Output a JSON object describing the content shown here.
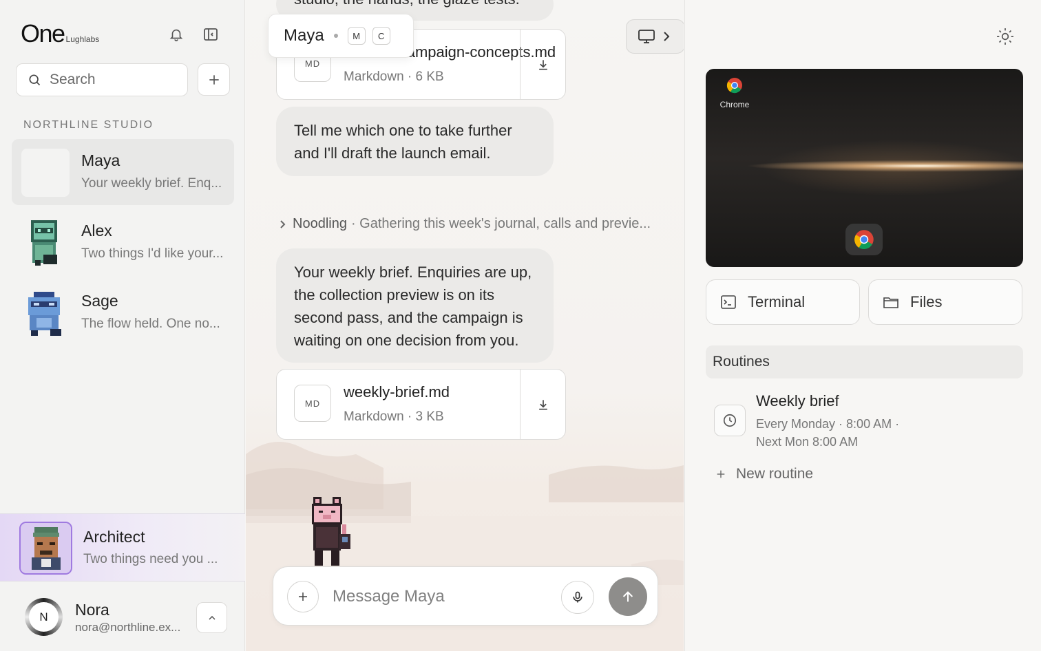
{
  "sidebar": {
    "logo_main": "One",
    "logo_sub": "Lughlabs",
    "search_placeholder": "Search",
    "section_title": "NORTHLINE STUDIO",
    "chats": [
      {
        "name": "Maya",
        "preview": "Your weekly brief. Enq..."
      },
      {
        "name": "Alex",
        "preview": "Two things I'd like your..."
      },
      {
        "name": "Sage",
        "preview": "The flow held. One no..."
      }
    ],
    "architect": {
      "name": "Architect",
      "preview": "Two things need you ..."
    },
    "user": {
      "initial": "N",
      "name": "Nora",
      "email": "nora@northline.ex..."
    }
  },
  "main": {
    "top_bubble_fragment": "studio, the hands, the glaze tests.",
    "popover": {
      "name": "Maya",
      "key1": "M",
      "key2": "C"
    },
    "file1": {
      "badge": "MD",
      "name": "autumn-campaign-concepts.md",
      "meta": "Markdown · 6 KB"
    },
    "bubble1": "Tell me which one to take further and I'll draft the launch email.",
    "thinking": {
      "label": "Noodling",
      "detail": "· Gathering this week's journal, calls and previe..."
    },
    "bubble2": "Your weekly brief. Enquiries are up, the collection preview is on its second pass, and the campaign is waiting on one decision from you.",
    "file2": {
      "badge": "MD",
      "name": "weekly-brief.md",
      "meta": "Markdown · 3 KB"
    },
    "composer_placeholder": "Message Maya"
  },
  "right": {
    "preview_app_label": "Chrome",
    "terminal_label": "Terminal",
    "files_label": "Files",
    "routines_header": "Routines",
    "routine": {
      "name": "Weekly brief",
      "schedule": "Every Monday · 8:00 AM ·",
      "next": "Next Mon 8:00 AM"
    },
    "new_routine_label": "New routine"
  },
  "colors": {
    "accent_purple": "#9f7ae0",
    "send_button": "#8e8d8b"
  }
}
